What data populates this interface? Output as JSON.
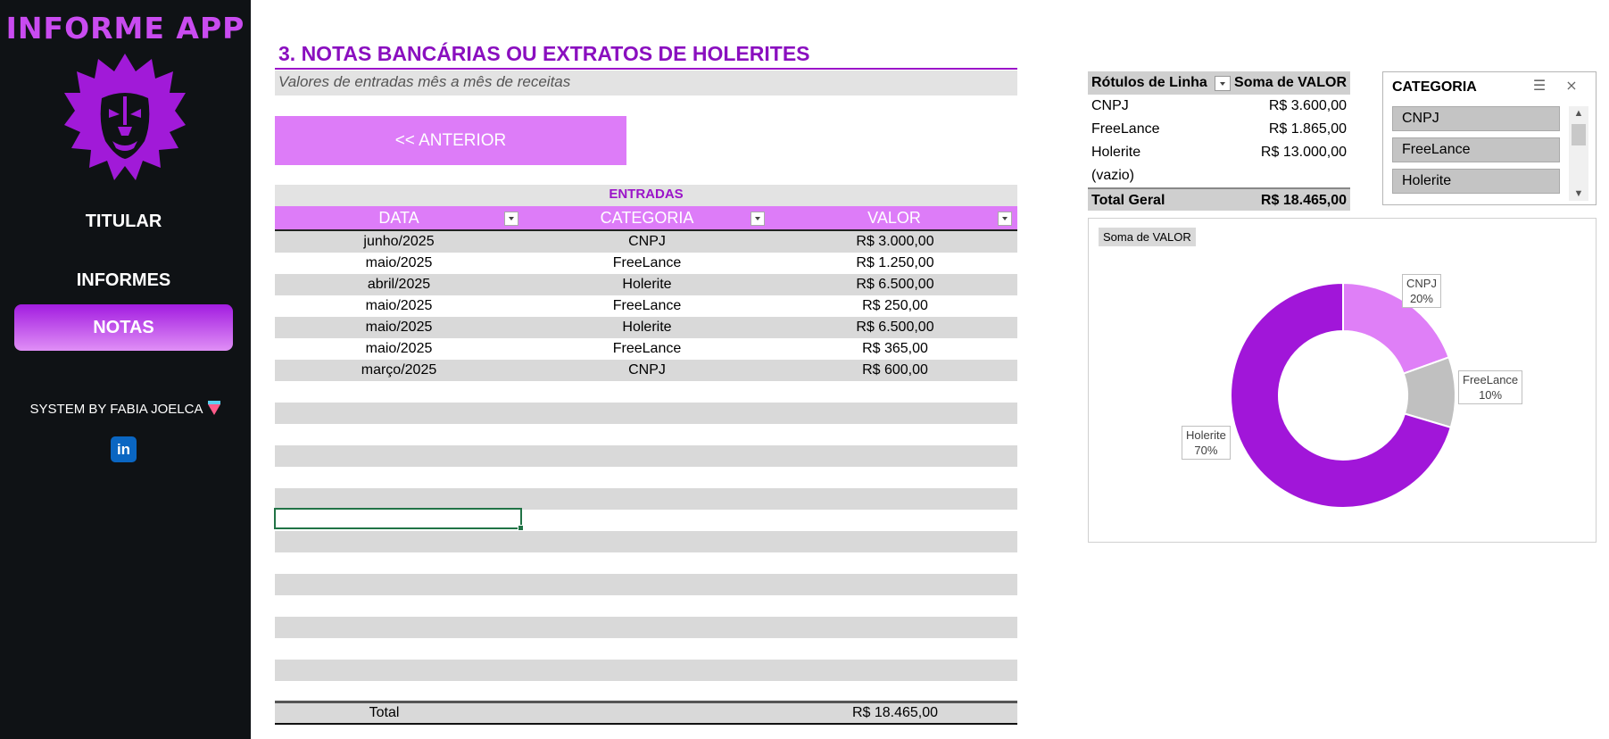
{
  "sidebar": {
    "app_title": "INFORME APP",
    "nav": [
      {
        "label": "TITULAR",
        "active": false
      },
      {
        "label": "INFORMES",
        "active": false
      },
      {
        "label": "NOTAS",
        "active": true
      }
    ],
    "credit": "SYSTEM BY FABIA JOELCA",
    "linkedin_label": "in"
  },
  "main": {
    "section_title": "3. NOTAS BANCÁRIAS OU EXTRATOS DE HOLERITES",
    "subtitle": "Valores de entradas mês a mês de receitas",
    "prev_button": "<< ANTERIOR",
    "table": {
      "caption": "ENTRADAS",
      "headers": [
        "DATA",
        "CATEGORIA",
        "VALOR"
      ],
      "rows": [
        [
          "junho/2025",
          "CNPJ",
          "R$ 3.000,00"
        ],
        [
          "maio/2025",
          "FreeLance",
          "R$ 1.250,00"
        ],
        [
          "abril/2025",
          "Holerite",
          "R$ 6.500,00"
        ],
        [
          "maio/2025",
          "FreeLance",
          "R$ 250,00"
        ],
        [
          "maio/2025",
          "Holerite",
          "R$ 6.500,00"
        ],
        [
          "maio/2025",
          "FreeLance",
          "R$ 365,00"
        ],
        [
          "março/2025",
          "CNPJ",
          "R$ 600,00"
        ]
      ],
      "total_label": "Total",
      "total_value": "R$ 18.465,00"
    }
  },
  "pivot": {
    "header_label": "Rótulos de Linha",
    "header_value": "Soma de VALOR",
    "rows": [
      {
        "label": "CNPJ",
        "value": "R$ 3.600,00"
      },
      {
        "label": "FreeLance",
        "value": "R$ 1.865,00"
      },
      {
        "label": "Holerite",
        "value": "R$ 13.000,00"
      },
      {
        "label": "(vazio)",
        "value": ""
      }
    ],
    "total_label": "Total Geral",
    "total_value": "R$ 18.465,00"
  },
  "slicer": {
    "title": "CATEGORIA",
    "items": [
      "CNPJ",
      "FreeLance",
      "Holerite"
    ]
  },
  "chart_data": {
    "type": "pie",
    "variant": "doughnut",
    "field_button": "Soma de VALOR",
    "slices": [
      {
        "name": "CNPJ",
        "value": 3600,
        "label": "20%",
        "color": "#df7ff7"
      },
      {
        "name": "FreeLance",
        "value": 1865,
        "label": "10%",
        "color": "#c0c0c0"
      },
      {
        "name": "Holerite",
        "value": 13000,
        "label": "70%",
        "color": "#a116d9"
      }
    ]
  },
  "colors": {
    "accent": "#9b14c9",
    "header_fill": "#dd7cf8",
    "sidebar_bg": "#0f1215",
    "linkedin": "#0a66c2"
  }
}
